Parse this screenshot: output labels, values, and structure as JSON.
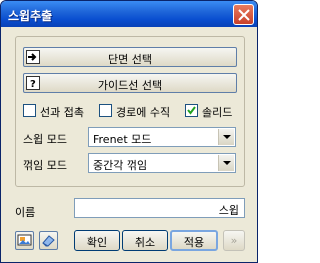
{
  "window": {
    "title": "스윕추출"
  },
  "selection_buttons": [
    {
      "label": "단면 선택",
      "icon": "arrow-right-icon"
    },
    {
      "label": "가이드선 선택",
      "icon": "question-icon"
    }
  ],
  "options": {
    "tangent_connect": {
      "label": "선과 접촉",
      "checked": false
    },
    "perpendicular_to_path": {
      "label": "경로에 수직",
      "checked": false
    },
    "solid": {
      "label": "솔리드",
      "checked": true
    }
  },
  "sweep_mode": {
    "label": "스윕 모드",
    "value": "Frenet 모드"
  },
  "bend_mode": {
    "label": "꺾임 모드",
    "value": "중간각 꺾임"
  },
  "name": {
    "label": "이름",
    "value": "스윕"
  },
  "footer": {
    "ok": "확인",
    "cancel": "취소",
    "apply": "적용",
    "more": "»"
  }
}
